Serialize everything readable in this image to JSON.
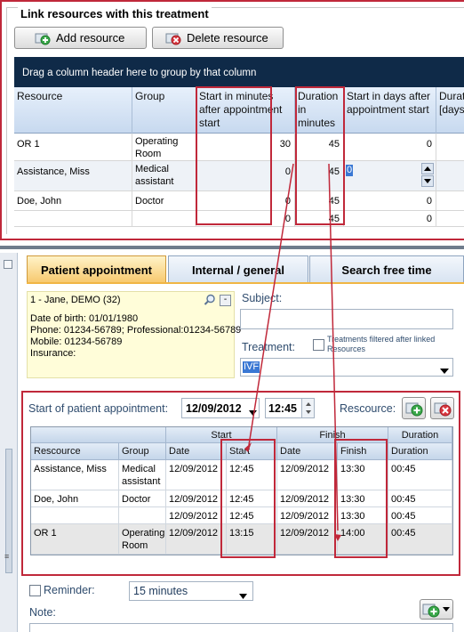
{
  "resources_section": {
    "title": "Link resources with this treatment",
    "add_label": "Add resource",
    "delete_label": "Delete resource",
    "group_hint": "Drag a column header here to group by that column",
    "columns": [
      "Resource",
      "Group",
      "Start in minutes after appointment start",
      "Duration in minutes",
      "Start in days after appointment start",
      "Duration [days]"
    ],
    "rows": [
      {
        "resource": "OR 1",
        "group": "Operating Room",
        "start_min": "30",
        "duration_min": "45",
        "start_days": "0"
      },
      {
        "resource": "Assistance, Miss",
        "group": "Medical assistant",
        "start_min": "0",
        "duration_min": "45",
        "start_days": "0"
      },
      {
        "resource": "Doe, John",
        "group": "Doctor",
        "start_min": "0",
        "duration_min": "45",
        "start_days": "0"
      },
      {
        "resource": "",
        "group": "",
        "start_min": "0",
        "duration_min": "45",
        "start_days": "0"
      }
    ]
  },
  "tabs": [
    "Patient appointment",
    "Internal / general",
    "Search free time"
  ],
  "patient": {
    "name": "1 - Jane, DEMO (32)",
    "dob": "Date of birth: 01/01/1980",
    "phone": "Phone: 01234-56789; Professional:01234-56789",
    "mobile": "Mobile: 01234-56789",
    "insurance": "Insurance:"
  },
  "subject_label": "Subject:",
  "treatment_label": "Treatment:",
  "treatment_filter_label": "Treatments filtered after linked Resources",
  "treatment_value": "IVF",
  "appointment": {
    "start_label": "Start of patient appointment:",
    "date": "12/09/2012",
    "time": "12:45",
    "resource_label": "Rescource:",
    "group_headers": [
      "Start",
      "Finish",
      "Duration"
    ],
    "columns": [
      "Rescource",
      "Group",
      "Date",
      "Start",
      "Date",
      "Finish",
      "Duration"
    ],
    "rows": [
      {
        "resource": "Assistance, Miss",
        "group": "Medical assistant",
        "sdate": "12/09/2012",
        "start": "12:45",
        "fdate": "12/09/2012",
        "finish": "13:30",
        "duration": "00:45"
      },
      {
        "resource": "Doe, John",
        "group": "Doctor",
        "sdate": "12/09/2012",
        "start": "12:45",
        "fdate": "12/09/2012",
        "finish": "13:30",
        "duration": "00:45"
      },
      {
        "resource": "",
        "group": "",
        "sdate": "12/09/2012",
        "start": "12:45",
        "fdate": "12/09/2012",
        "finish": "13:30",
        "duration": "00:45"
      },
      {
        "resource": "OR 1",
        "group": "Operating Room",
        "sdate": "12/09/2012",
        "start": "13:15",
        "fdate": "12/09/2012",
        "finish": "14:00",
        "duration": "00:45"
      }
    ]
  },
  "reminder_label": "Reminder:",
  "reminder_value": "15 minutes",
  "note_label": "Note:",
  "colors": {
    "highlight_red": "#c0283a",
    "group_bar": "#0f2a48",
    "active_tab": "#f7c86c",
    "patient_bg": "#fffdd9"
  }
}
